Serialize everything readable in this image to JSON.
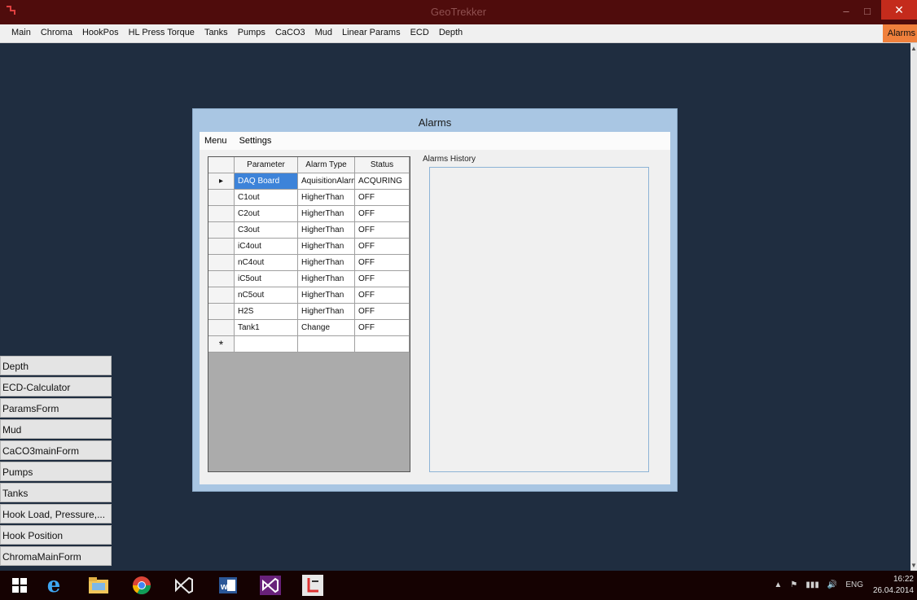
{
  "window": {
    "title": "GeoTrekker",
    "minimize_glyph": "–",
    "restore_glyph": "□",
    "close_glyph": "✕"
  },
  "menubar": {
    "items": [
      "Main",
      "Chroma",
      "HookPos",
      "HL Press Torque",
      "Tanks",
      "Pumps",
      "CaCO3",
      "Mud",
      "Linear Params",
      "ECD",
      "Depth"
    ],
    "alarms_label": "Alarms",
    "alarms_color": "#f0803c"
  },
  "alarms_window": {
    "title": "Alarms",
    "menu": [
      "Menu",
      "Settings"
    ],
    "grid": {
      "columns": [
        "Parameter",
        "Alarm Type",
        "Status"
      ],
      "rows": [
        {
          "marker": "▸",
          "parameter": "DAQ Board",
          "alarm_type": "AquisitionAlarm",
          "status": "ACQURING"
        },
        {
          "marker": "",
          "parameter": "C1out",
          "alarm_type": "HigherThan",
          "status": "OFF"
        },
        {
          "marker": "",
          "parameter": "C2out",
          "alarm_type": "HigherThan",
          "status": "OFF"
        },
        {
          "marker": "",
          "parameter": "C3out",
          "alarm_type": "HigherThan",
          "status": "OFF"
        },
        {
          "marker": "",
          "parameter": "iC4out",
          "alarm_type": "HigherThan",
          "status": "OFF"
        },
        {
          "marker": "",
          "parameter": "nC4out",
          "alarm_type": "HigherThan",
          "status": "OFF"
        },
        {
          "marker": "",
          "parameter": "iC5out",
          "alarm_type": "HigherThan",
          "status": "OFF"
        },
        {
          "marker": "",
          "parameter": "nC5out",
          "alarm_type": "HigherThan",
          "status": "OFF"
        },
        {
          "marker": "",
          "parameter": "H2S",
          "alarm_type": "HigherThan",
          "status": "OFF"
        },
        {
          "marker": "",
          "parameter": "Tank1",
          "alarm_type": "Change",
          "status": "OFF"
        },
        {
          "marker": "*",
          "parameter": "",
          "alarm_type": "",
          "status": ""
        }
      ]
    },
    "history_label": "Alarms History"
  },
  "minimized_forms": [
    "Depth",
    "ECD-Calculator",
    "ParamsForm",
    "Mud",
    "CaCO3mainForm",
    "Pumps",
    "Tanks",
    "Hook Load, Pressure,...",
    "Hook Position",
    "ChromaMainForm"
  ],
  "taskbar": {
    "apps": [
      "windows-start-icon",
      "internet-explorer-icon",
      "file-explorer-icon",
      "chrome-icon",
      "visual-studio-icon",
      "word-icon",
      "visual-studio-2-icon",
      "geotrekker-icon"
    ],
    "tray_lang": "ENG",
    "time": "16:22",
    "date": "26.04.2014"
  }
}
